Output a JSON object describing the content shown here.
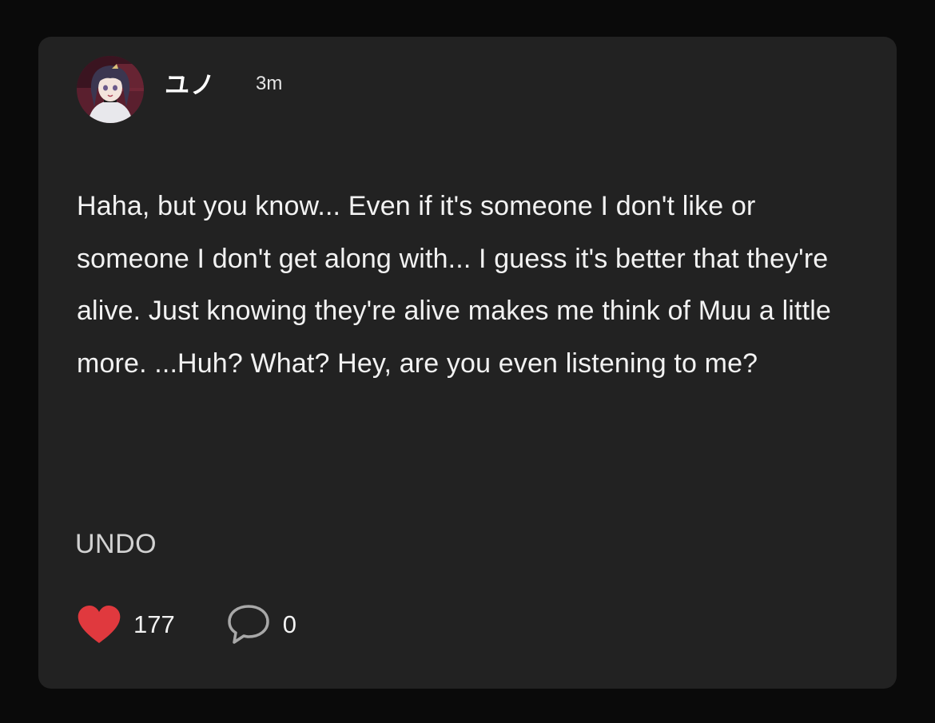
{
  "post": {
    "author": {
      "name": "ユノ",
      "avatar_icon": "avatar-image"
    },
    "timestamp": "3m",
    "message": "Haha, but you know... Even if it's someone I don't like or someone I don't get along with... I guess it's better that they're alive. Just knowing they're alive makes me think of Muu a little more. ...Huh? What? Hey, are you even listening to me?",
    "undo_label": "UNDO",
    "likes": {
      "icon": "heart-icon",
      "count": "177",
      "color": "#e0393e"
    },
    "comments": {
      "icon": "speech-bubble-icon",
      "count": "0"
    }
  },
  "colors": {
    "page_background": "#0a0a0a",
    "card_background": "#222222",
    "text": "#f2f2f2"
  }
}
